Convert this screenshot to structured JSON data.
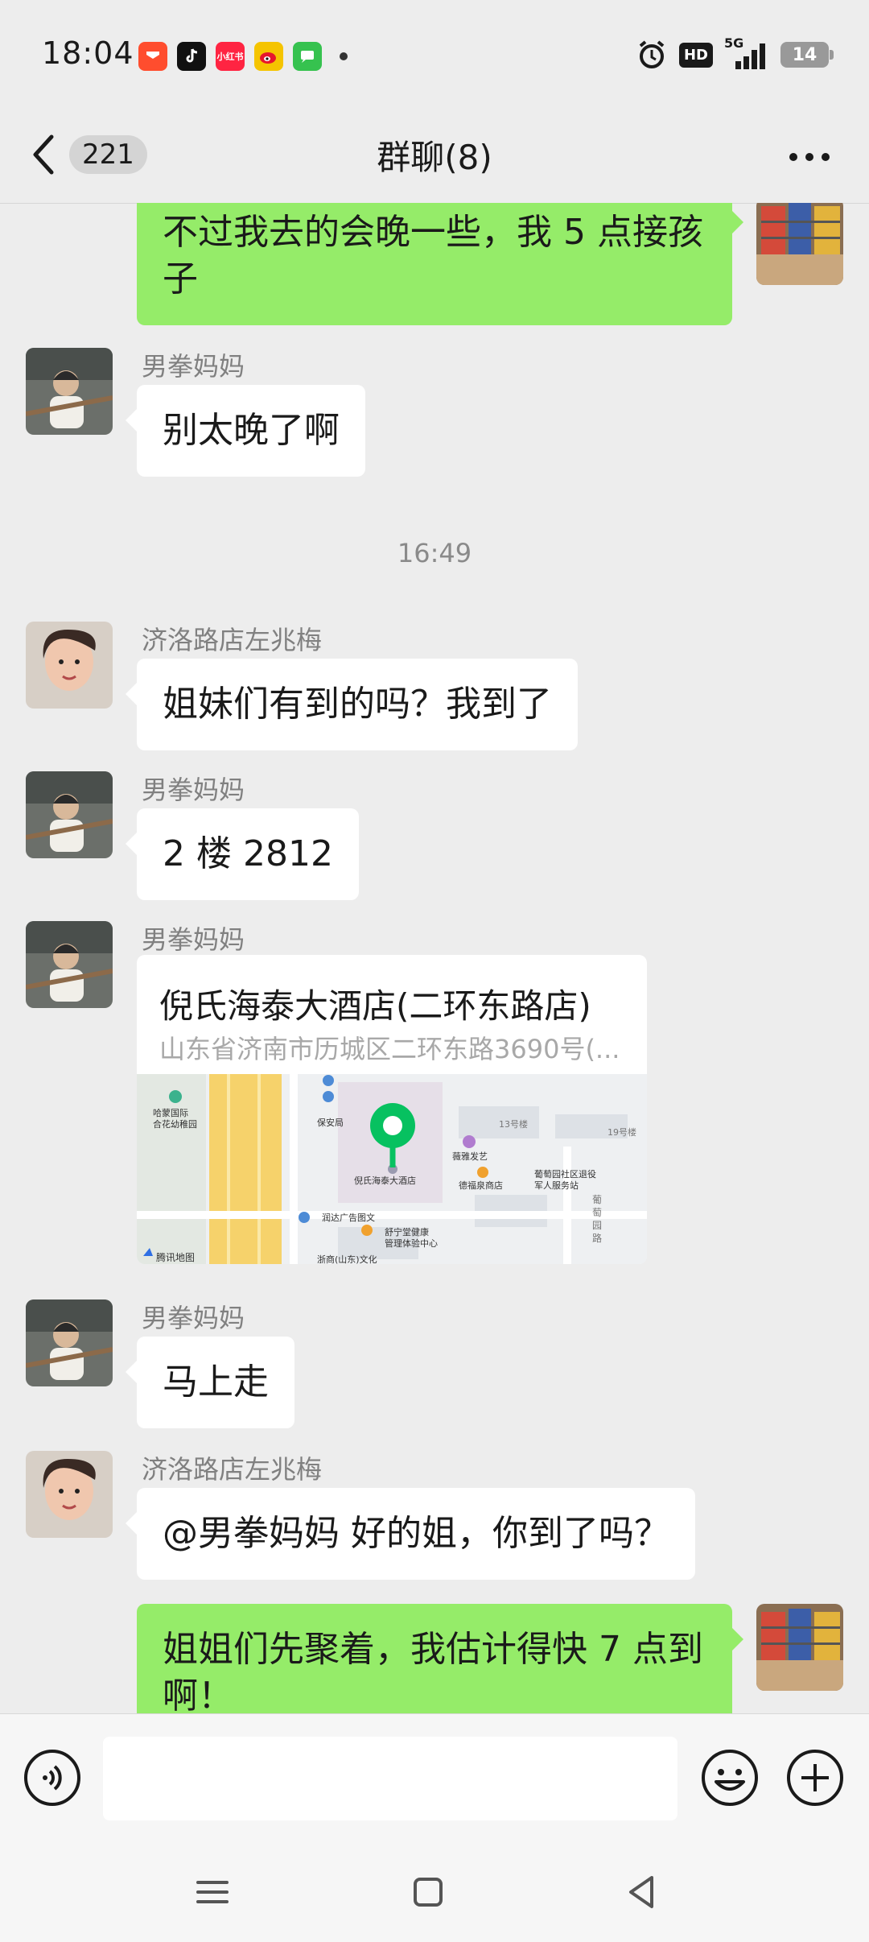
{
  "status_bar": {
    "time": "18:04",
    "apps": [
      {
        "icon": "app-icon-red",
        "color": "#ff4d2e",
        "label": ""
      },
      {
        "icon": "tiktok-icon",
        "color": "#111111",
        "label": "♪"
      },
      {
        "icon": "xiaohongshu-icon",
        "color": "#ff2442",
        "label": "小红书"
      },
      {
        "icon": "weibo-icon",
        "color": "#f5c400",
        "label": "微"
      },
      {
        "icon": "messages-icon",
        "color": "#36c24f",
        "label": ""
      }
    ],
    "hd_label": "HD",
    "network_label": "5G",
    "battery": "14"
  },
  "header": {
    "unread_count": "221",
    "title": "群聊(8)"
  },
  "messages": {
    "m1": {
      "text": "不过我去的会晚一些，我 5 点接孩子"
    },
    "m2": {
      "sender": "男拳妈妈",
      "text": "别太晚了啊"
    },
    "time1": "16:49",
    "m3": {
      "sender": "济洛路店左兆梅",
      "text": "姐妹们有到的吗？我到了"
    },
    "m4": {
      "sender": "男拳妈妈",
      "text": "2 楼 2812"
    },
    "m5": {
      "sender": "男拳妈妈",
      "location_name": "倪氏海泰大酒店(二环东路店)",
      "location_address": "山东省济南市历城区二环东路3690号(...",
      "map": {
        "poi_main": "倪氏海泰大酒店",
        "poi_1": "哈蒙国际\n合花幼稚园",
        "poi_2": "保安局",
        "poi_3": "薇雅发艺",
        "poi_4": "德福泉商店",
        "poi_5": "葡萄园社区退役\n军人服务站",
        "poi_6": "润达广告图文",
        "poi_7": "舒宁堂健康\n管理体验中心",
        "poi_8": "13号楼",
        "poi_9": "19号楼",
        "poi_10": "葡萄园路",
        "poi_11": "浙商(山东)文化",
        "watermark": "腾讯地图"
      }
    },
    "m6": {
      "sender": "男拳妈妈",
      "text": "马上走"
    },
    "m7": {
      "sender": "济洛路店左兆梅",
      "text": "@男拳妈妈  好的姐，你到了吗？"
    },
    "m8": {
      "text": "姐姐们先聚着，我估计得快 7 点到啊！"
    }
  },
  "colors": {
    "out_bubble": "#95ec69",
    "in_bubble": "#ffffff",
    "background": "#ededed",
    "map_pin": "#07c160"
  }
}
